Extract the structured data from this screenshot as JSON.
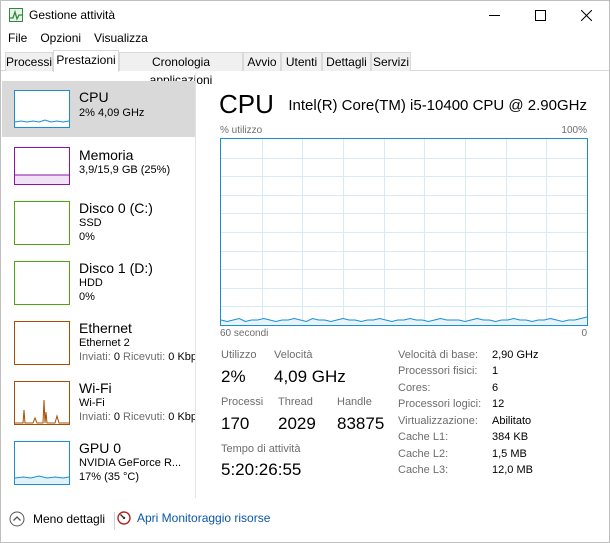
{
  "window": {
    "title": "Gestione attività"
  },
  "menu": [
    "File",
    "Opzioni",
    "Visualizza"
  ],
  "tabs": [
    "Processi",
    "Prestazioni",
    "Cronologia applicazioni",
    "Avvio",
    "Utenti",
    "Dettagli",
    "Servizi"
  ],
  "active_tab": "Prestazioni",
  "sidebar": {
    "items": [
      {
        "name": "CPU",
        "line1": "2% 4,09 GHz",
        "color": "#1a8ed0",
        "icon": "cpu-graph-thumbnail"
      },
      {
        "name": "Memoria",
        "line1": "3,9/15,9 GB (25%)",
        "color": "#8b12ae",
        "icon": "memory-graph-thumbnail"
      },
      {
        "name": "Disco 0 (C:)",
        "line1": "SSD",
        "line2": "0%",
        "color": "#4da60c",
        "icon": "disk-graph-thumbnail"
      },
      {
        "name": "Disco 1 (D:)",
        "line1": "HDD",
        "line2": "0%",
        "color": "#4da60c",
        "icon": "disk-graph-thumbnail"
      },
      {
        "name": "Ethernet",
        "line1": "Ethernet 2",
        "sent_label": "Inviati:",
        "sent_value": "0",
        "recv_label": "Ricevuti:",
        "recv_value": "0 Kbp",
        "color": "#a74f01",
        "icon": "network-graph-thumbnail"
      },
      {
        "name": "Wi-Fi",
        "line1": "Wi-Fi",
        "sent_label": "Inviati:",
        "sent_value": "0",
        "recv_label": "Ricevuti:",
        "recv_value": "0 Kbp",
        "color": "#a74f01",
        "icon": "network-graph-thumbnail"
      },
      {
        "name": "GPU 0",
        "line1": "NVIDIA GeForce R...",
        "line2": "17% (35 °C)",
        "color": "#1a8ed0",
        "icon": "gpu-graph-thumbnail"
      }
    ]
  },
  "main": {
    "title": "CPU",
    "model": "Intel(R) Core(TM) i5-10400 CPU @ 2.90GHz",
    "axis": {
      "top_left": "% utilizzo",
      "top_right": "100%",
      "bottom_left": "60 secondi",
      "bottom_right": "0"
    },
    "stats": {
      "utilizzo_label": "Utilizzo",
      "utilizzo_value": "2%",
      "velocita_label": "Velocità",
      "velocita_value": "4,09 GHz",
      "processi_label": "Processi",
      "processi_value": "170",
      "thread_label": "Thread",
      "thread_value": "2029",
      "handle_label": "Handle",
      "handle_value": "83875",
      "uptime_label": "Tempo di attività",
      "uptime_value": "5:20:26:55"
    },
    "details": [
      {
        "label": "Velocità di base:",
        "value": "2,90 GHz"
      },
      {
        "label": "Processori fisici:",
        "value": "1"
      },
      {
        "label": "Cores:",
        "value": "6"
      },
      {
        "label": "Processori logici:",
        "value": "12"
      },
      {
        "label": "Virtualizzazione:",
        "value": "Abilitato"
      },
      {
        "label": "Cache L1:",
        "value": "384 KB"
      },
      {
        "label": "Cache L2:",
        "value": "1,5 MB"
      },
      {
        "label": "Cache L3:",
        "value": "12,0 MB"
      }
    ]
  },
  "footer": {
    "less_details": "Meno dettagli",
    "open_monitor": "Apri Monitoraggio risorse"
  },
  "colors": {
    "accent": "#1a8ed0",
    "grid": "#d9eaf7",
    "link": "#0b57a8"
  }
}
